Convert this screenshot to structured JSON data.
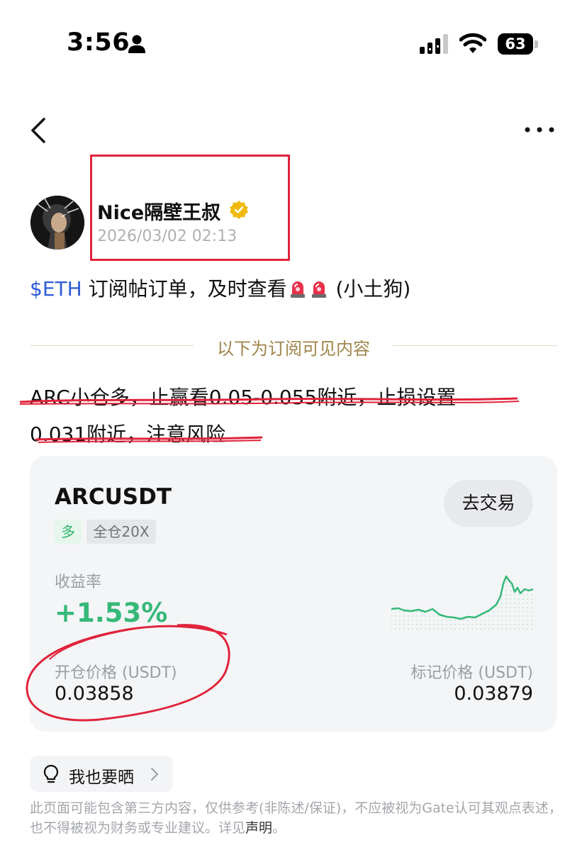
{
  "status_bar": {
    "time": "3:56",
    "battery": "63",
    "icons": [
      "person-icon",
      "signal-icon",
      "wifi-icon",
      "battery-icon"
    ]
  },
  "nav": {
    "back_icon": "chevron-left-icon",
    "more_icon": "more-dots-icon"
  },
  "author": {
    "name": "Nice隔壁王叔",
    "time": "2026/03/02 02:13",
    "verified_color": "#f0b90b"
  },
  "post": {
    "ticker": "$ETH",
    "text": " 订阅帖订单，及时查看",
    "suffix": " (小土狗)"
  },
  "divider": {
    "label": "以下为订阅可见内容"
  },
  "content": {
    "line1": "ARC小仓多，止赢看0.05-0.055附近，止损设置",
    "line2": "0.031附近，注意风险"
  },
  "card": {
    "pair": "ARCUSDT",
    "trade_button": "去交易",
    "tag_direction": "多",
    "tag_mode": "全仓20X",
    "yield_label": "收益率",
    "yield_value": "+1.53%",
    "entry_label": "开仓价格 (USDT)",
    "entry_value": "0.03858",
    "mark_label": "标记价格 (USDT)",
    "mark_value": "0.03879",
    "accent_green": "#35b878"
  },
  "share": {
    "label": "我也要晒"
  },
  "disclaimer": {
    "text": "此页面可能包含第三方内容，仅供参考(非陈述/保证)，不应被视为Gate认可其观点表述，也不得被视为财务或专业建议。详见",
    "link": "声明",
    "end": "。"
  },
  "annotation_color": "#e0233a"
}
